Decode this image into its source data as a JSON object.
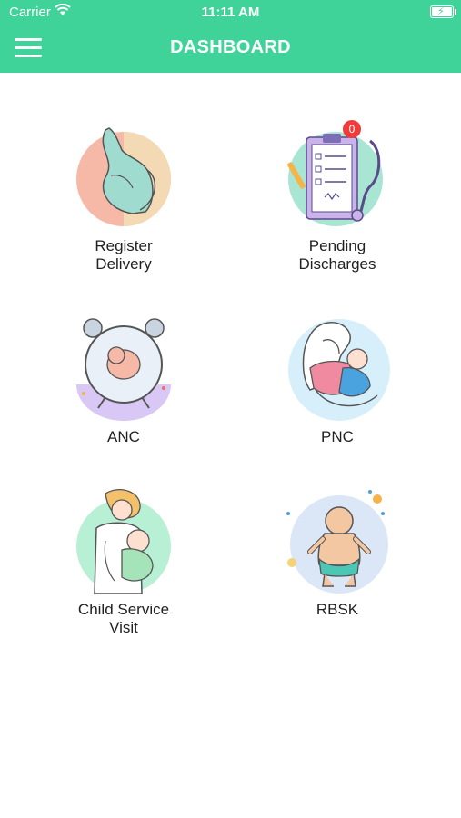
{
  "status_bar": {
    "carrier": "Carrier",
    "time": "11:11 AM"
  },
  "header": {
    "title": "DASHBOARD",
    "menu_icon": "hamburger-menu-icon"
  },
  "tiles": [
    {
      "label": "Register\nDelivery",
      "icon": "pregnancy-icon"
    },
    {
      "label": "Pending\nDischarges",
      "icon": "clipboard-stethoscope-icon",
      "badge": "0"
    },
    {
      "label": "ANC",
      "icon": "fetus-clock-icon"
    },
    {
      "label": "PNC",
      "icon": "mother-newborn-icon"
    },
    {
      "label": "Child Service\nVisit",
      "icon": "doctor-baby-icon"
    },
    {
      "label": "RBSK",
      "icon": "baby-icon"
    }
  ],
  "colors": {
    "accent": "#3fd399",
    "badge": "#ef3b3b"
  }
}
